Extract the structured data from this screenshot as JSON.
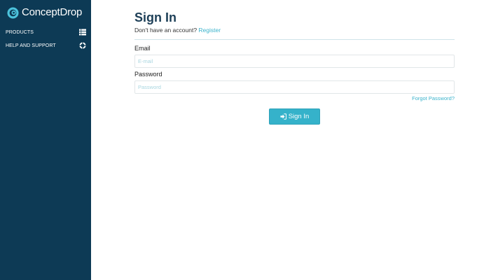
{
  "brand": {
    "name": "ConceptDrop",
    "icon": "concept-drop-logo-icon"
  },
  "sidebar": {
    "items": [
      {
        "label": "PRODUCTS",
        "icon": "list-icon"
      },
      {
        "label": "HELP AND SUPPORT",
        "icon": "life-ring-icon"
      }
    ]
  },
  "main": {
    "title": "Sign In",
    "register_prompt": "Don't have an account?",
    "register_link": "Register",
    "email": {
      "label": "Email",
      "placeholder": "E-mail",
      "value": ""
    },
    "password": {
      "label": "Password",
      "placeholder": "Password",
      "value": ""
    },
    "forgot_link": "Forgot Password?",
    "submit": {
      "label": "Sign In",
      "icon": "sign-in-icon"
    }
  },
  "colors": {
    "sidebar_bg": "#0d3a55",
    "accent": "#35b2ca",
    "link": "#3bb3cc",
    "title": "#1d3f57"
  }
}
